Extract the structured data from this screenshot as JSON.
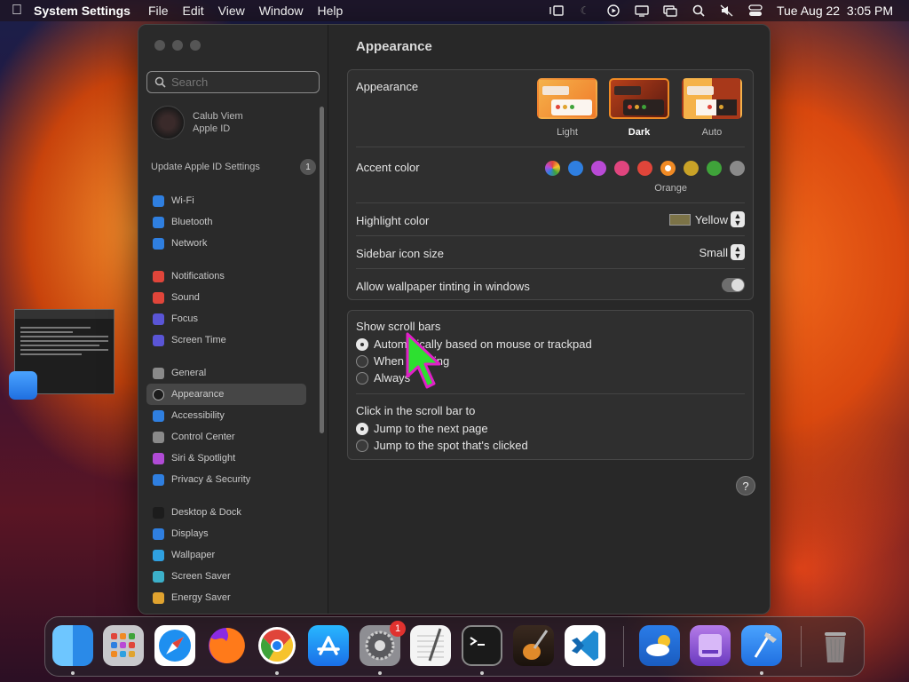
{
  "menubar": {
    "app_name": "System Settings",
    "menus": [
      "File",
      "Edit",
      "View",
      "Window",
      "Help"
    ],
    "clock": "Tue Aug 22  3:05 PM"
  },
  "sidebar": {
    "search_placeholder": "Search",
    "account_name": "Calub Viem",
    "account_sub": "Apple ID",
    "update_label": "Update Apple ID Settings",
    "update_count": "1",
    "items": [
      {
        "label": "Wi-Fi",
        "color": "#2f7fe0"
      },
      {
        "label": "Bluetooth",
        "color": "#2f7fe0"
      },
      {
        "label": "Network",
        "color": "#2f7fe0"
      },
      {
        "label": "Notifications",
        "color": "#e0453a"
      },
      {
        "label": "Sound",
        "color": "#e0453a"
      },
      {
        "label": "Focus",
        "color": "#5a55d6"
      },
      {
        "label": "Screen Time",
        "color": "#5a55d6"
      },
      {
        "label": "General",
        "color": "#8a8a8a"
      },
      {
        "label": "Appearance",
        "color": "#1c1c1c"
      },
      {
        "label": "Accessibility",
        "color": "#2f7fe0"
      },
      {
        "label": "Control Center",
        "color": "#8a8a8a"
      },
      {
        "label": "Siri & Spotlight",
        "color": "#b14bd6"
      },
      {
        "label": "Privacy & Security",
        "color": "#2f7fe0"
      },
      {
        "label": "Desktop & Dock",
        "color": "#1c1c1c"
      },
      {
        "label": "Displays",
        "color": "#2f7fe0"
      },
      {
        "label": "Wallpaper",
        "color": "#2fa0e0"
      },
      {
        "label": "Screen Saver",
        "color": "#3cb0c9"
      },
      {
        "label": "Energy Saver",
        "color": "#e0a32f"
      }
    ]
  },
  "main": {
    "title": "Appearance",
    "appearance_label": "Appearance",
    "themes": [
      "Light",
      "Dark",
      "Auto"
    ],
    "accent_label": "Accent color",
    "accent_selected_name": "Orange",
    "accent_colors": [
      "#ff5f57",
      "#2f7fe0",
      "#b94ad6",
      "#e0457e",
      "#e0453a",
      "#f08a24",
      "#c9a227",
      "#3fa33a",
      "#8a8a8a"
    ],
    "highlight_label": "Highlight color",
    "highlight_value": "Yellow",
    "icon_size_label": "Sidebar icon size",
    "icon_size_value": "Small",
    "tinting_label": "Allow wallpaper tinting in windows",
    "scroll_title": "Show scroll bars",
    "scroll_options": [
      "Automatically based on mouse or trackpad",
      "When scrolling",
      "Always"
    ],
    "click_title": "Click in the scroll bar to",
    "click_options": [
      "Jump to the next page",
      "Jump to the spot that's clicked"
    ],
    "help": "?"
  },
  "dock": {
    "apps": [
      "Finder",
      "Launchpad",
      "Safari",
      "Firefox",
      "Chrome",
      "App Store",
      "System Settings",
      "TextEdit",
      "Terminal",
      "GarageBand",
      "VS Code",
      "Weather",
      "Disk Utility",
      "Xcode",
      "Trash"
    ],
    "settings_badge": "1"
  }
}
